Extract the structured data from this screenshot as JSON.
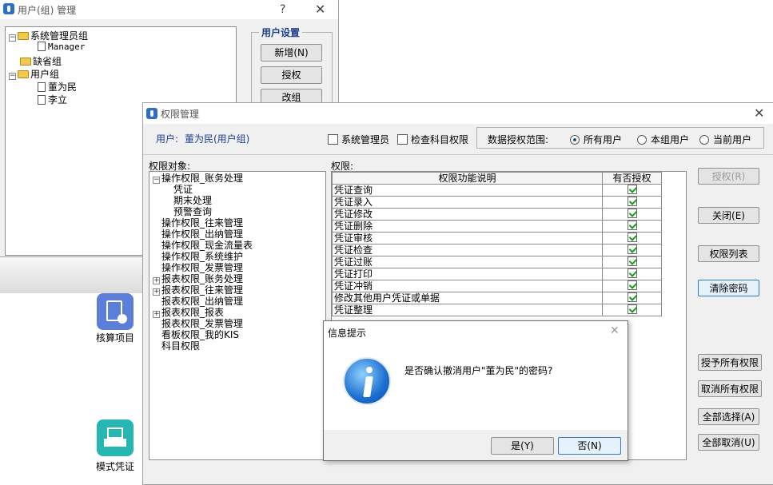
{
  "background": {
    "items": [
      {
        "label": "核算项目",
        "icon": "ledger-icon",
        "color": "#5b7fd9"
      },
      {
        "label": "模式凭证",
        "icon": "voucher-print-icon",
        "color": "#27b6b1"
      }
    ]
  },
  "user_group_window": {
    "title": "用户(组) 管理",
    "help": "?",
    "close": "✕",
    "tree": [
      {
        "label": "系统管理员组",
        "type": "folder",
        "toggle": "⊟"
      },
      {
        "label": "Manager",
        "type": "user"
      },
      {
        "label": "缺省组",
        "type": "folder"
      },
      {
        "label": "用户组",
        "type": "folder",
        "toggle": "⊟"
      },
      {
        "label": "董为民",
        "type": "user"
      },
      {
        "label": "李立",
        "type": "user"
      }
    ],
    "settings_title": "用户设置",
    "buttons": [
      "新增(N)",
      "授权",
      "改组"
    ]
  },
  "perm_window": {
    "title": "权限管理",
    "close": "✕",
    "user_label": "用户:",
    "user_value": "董为民(用户组)",
    "checkboxes": [
      "系统管理员",
      "检查科目权限"
    ],
    "scope_label": "数据授权范围:",
    "scope_options": [
      "所有用户",
      "本组用户",
      "当前用户"
    ],
    "scope_selected": "所有用户",
    "objects_label": "权限对象:",
    "perm_label": "权限:",
    "object_tree": [
      {
        "label": "操作权限_账务处理",
        "toggle": "⊟",
        "indent": 0
      },
      {
        "label": "凭证",
        "indent": 1
      },
      {
        "label": "期末处理",
        "indent": 1
      },
      {
        "label": "预警查询",
        "indent": 1
      },
      {
        "label": "操作权限_往来管理",
        "indent": 0
      },
      {
        "label": "操作权限_出纳管理",
        "indent": 0
      },
      {
        "label": "操作权限_现金流量表",
        "indent": 0
      },
      {
        "label": "操作权限_系统维护",
        "indent": 0
      },
      {
        "label": "操作权限_发票管理",
        "indent": 0
      },
      {
        "label": "报表权限_账务处理",
        "toggle": "⊞",
        "indent": 0
      },
      {
        "label": "报表权限_往来管理",
        "toggle": "⊞",
        "indent": 0
      },
      {
        "label": "报表权限_出纳管理",
        "indent": 0
      },
      {
        "label": "报表权限_报表",
        "toggle": "⊞",
        "indent": 0
      },
      {
        "label": "报表权限_发票管理",
        "indent": 0
      },
      {
        "label": "看板权限_我的KIS",
        "indent": 0
      },
      {
        "label": "科目权限",
        "indent": 0
      }
    ],
    "table_headers": [
      "权限功能说明",
      "有否授权"
    ],
    "table_rows": [
      "凭证查询",
      "凭证录入",
      "凭证修改",
      "凭证删除",
      "凭证审核",
      "凭证检查",
      "凭证过账",
      "凭证打印",
      "凭证冲销",
      "修改其他用户凭证或单据",
      "凭证整理"
    ],
    "buttons": [
      {
        "label": "授权(R)",
        "disabled": true
      },
      {
        "label": "关闭(E)"
      },
      {
        "label": "权限列表"
      },
      {
        "label": "清除密码"
      },
      {
        "label": "授予所有权限"
      },
      {
        "label": "取消所有权限"
      },
      {
        "label": "全部选择(A)"
      },
      {
        "label": "全部取消(U)"
      }
    ]
  },
  "dialog": {
    "title": "信息提示",
    "close": "✕",
    "message": "是否确认撤消用户\"董为民\"的密码?",
    "yes": "是(Y)",
    "no": "否(N)"
  }
}
